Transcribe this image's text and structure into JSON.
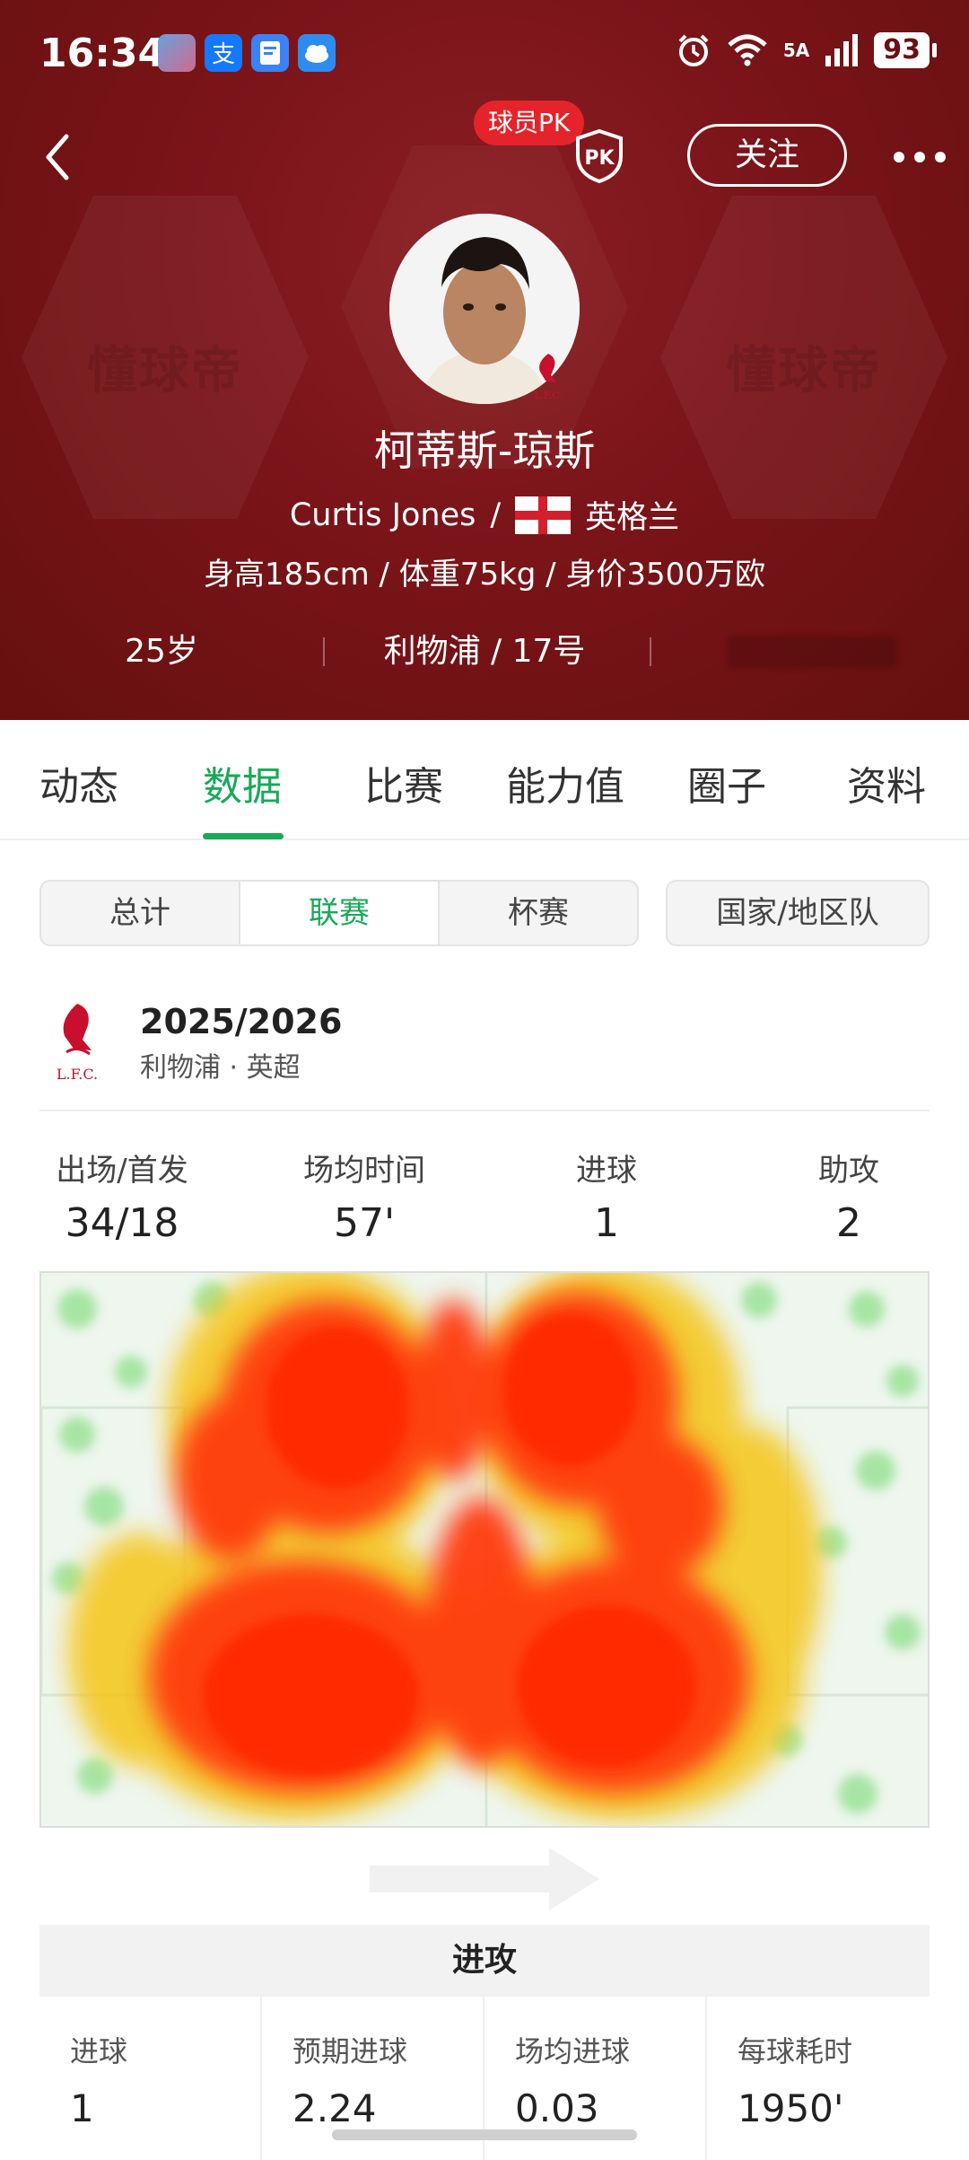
{
  "status_bar": {
    "time": "16:34",
    "network": "5A",
    "battery": "93"
  },
  "header": {
    "pk_label": "球员PK",
    "pk_badge": "PK",
    "follow_label": "关注",
    "watermark": "懂球帝"
  },
  "player": {
    "name_cn": "柯蒂斯-琼斯",
    "name_en": "Curtis Jones",
    "sep": "/",
    "nationality": "英格兰",
    "body_info": "身高185cm / 体重75kg / 身价3500万欧",
    "age": "25岁",
    "club_number": "利物浦 / 17号"
  },
  "tabs": [
    "动态",
    "数据",
    "比赛",
    "能力值",
    "圈子",
    "资料"
  ],
  "segment": {
    "items": [
      "总计",
      "联赛",
      "杯赛"
    ],
    "national": "国家/地区队"
  },
  "season": {
    "club_logo_text": "L.F.C.",
    "year": "2025/2026",
    "league": "利物浦 · 英超"
  },
  "stats": [
    {
      "label": "出场/首发",
      "value": "34/18"
    },
    {
      "label": "场均时间",
      "value": "57'"
    },
    {
      "label": "进球",
      "value": "1"
    },
    {
      "label": "助攻",
      "value": "2"
    }
  ],
  "attack": {
    "title": "进攻",
    "cells": [
      {
        "label": "进球",
        "value": "1"
      },
      {
        "label": "预期进球",
        "value": "2.24"
      },
      {
        "label": "场均进球",
        "value": "0.03"
      },
      {
        "label": "每球耗时",
        "value": "1950'"
      }
    ]
  },
  "colors": {
    "header_red": "#7a1419",
    "accent_green": "#18a957",
    "pk_red": "#e5232b"
  },
  "icons": [
    "back-arrow-icon",
    "pk-shield-icon",
    "more-dots-icon",
    "england-flag-icon",
    "liverpool-crest-icon",
    "direction-arrow-icon"
  ]
}
